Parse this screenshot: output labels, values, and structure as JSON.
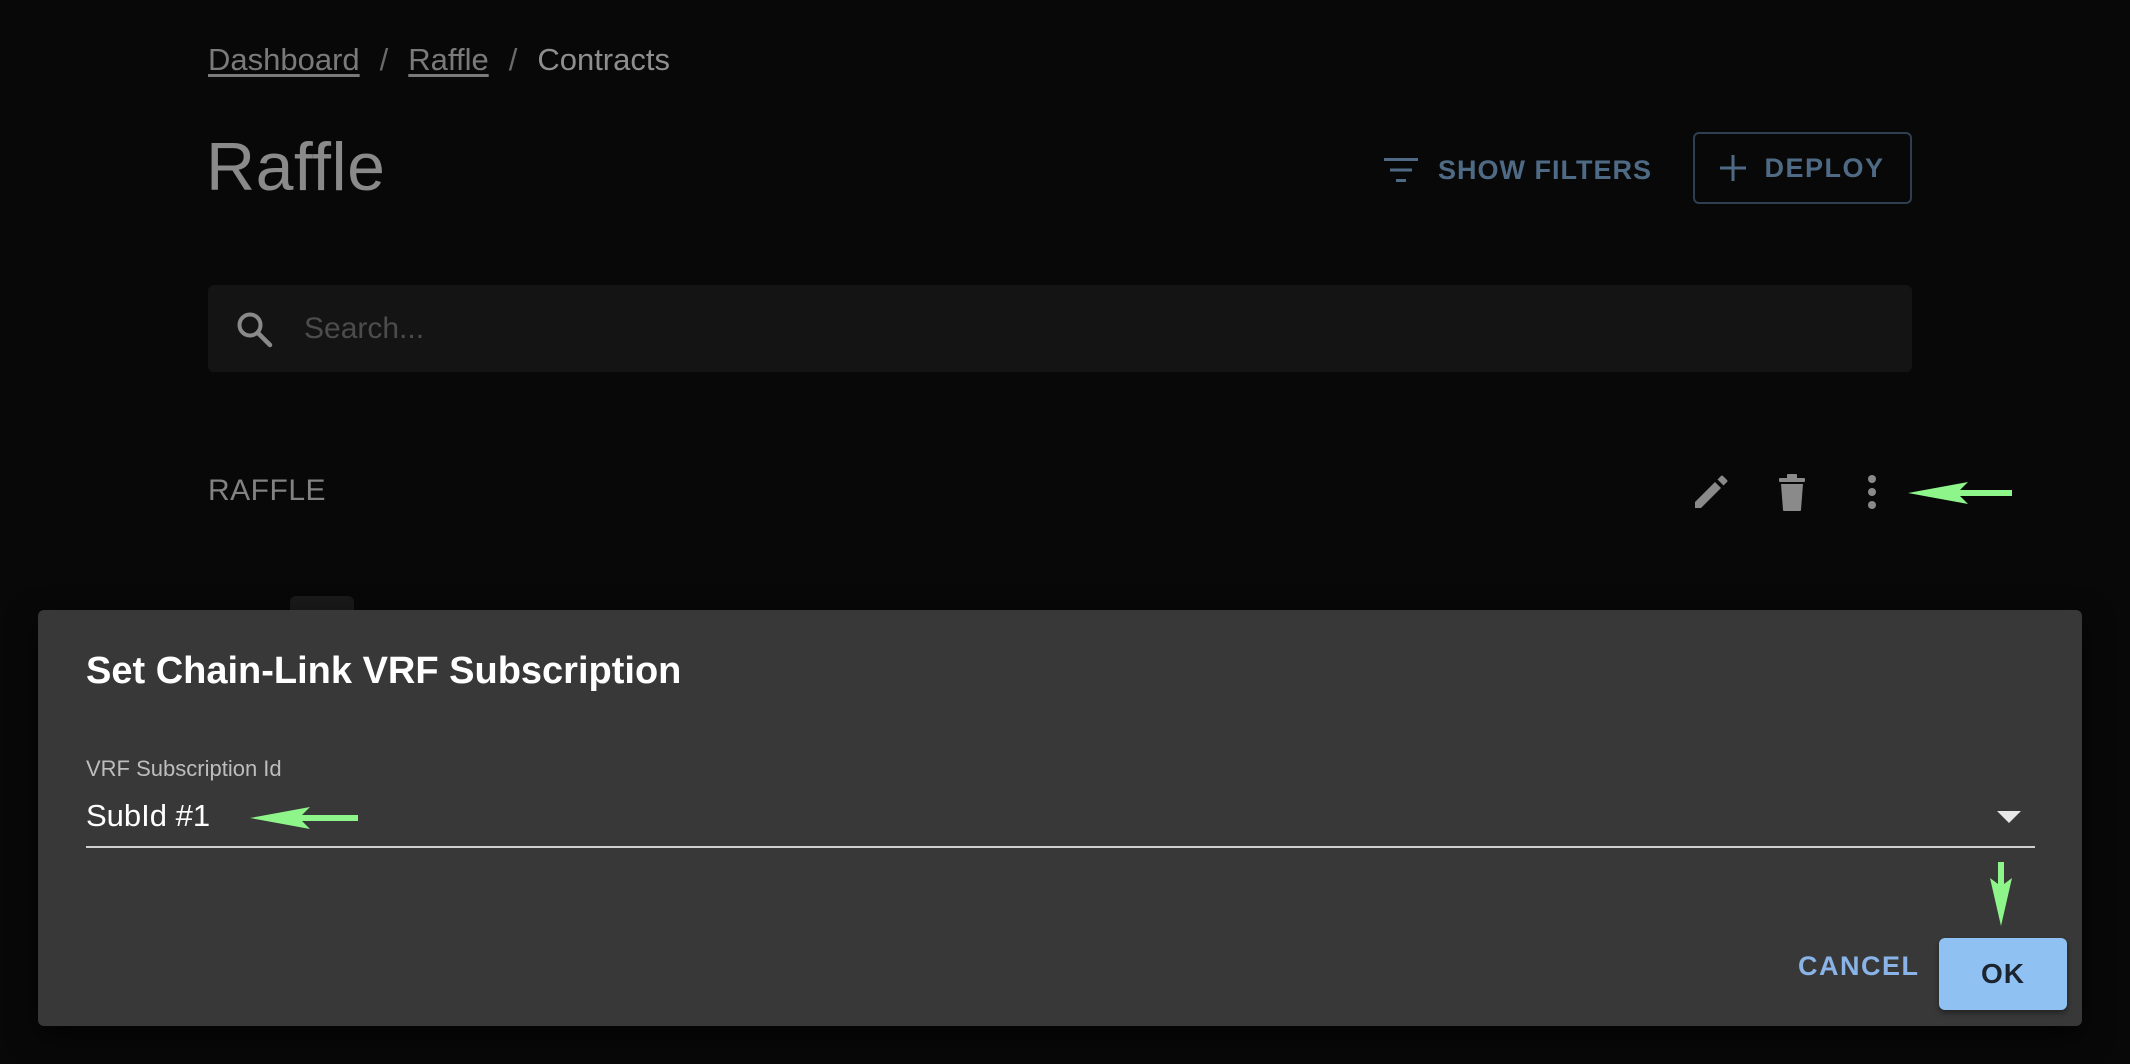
{
  "breadcrumb": {
    "items": [
      "Dashboard",
      "Raffle"
    ],
    "current": "Contracts",
    "separator": "/"
  },
  "page": {
    "title": "Raffle"
  },
  "toolbar": {
    "filters_label": "SHOW FILTERS",
    "deploy_label": "DEPLOY"
  },
  "search": {
    "placeholder": "Search...",
    "value": ""
  },
  "list": {
    "row_label": "RAFFLE"
  },
  "dialog": {
    "title": "Set Chain-Link VRF Subscription",
    "field_label": "VRF Subscription Id",
    "selected_value": "SubId #1",
    "cancel_label": "CANCEL",
    "ok_label": "OK"
  },
  "colors": {
    "accent": "#90c1f3",
    "link_blue": "#8ab4e8",
    "annotation_arrow": "#8ef58a",
    "dialog_bg": "#383838",
    "page_bg": "#080808"
  },
  "icons": [
    "filter-icon",
    "plus-icon",
    "search-icon",
    "pencil-icon",
    "trash-icon",
    "more-vert-icon",
    "caret-down-icon",
    "annotation-arrow"
  ]
}
